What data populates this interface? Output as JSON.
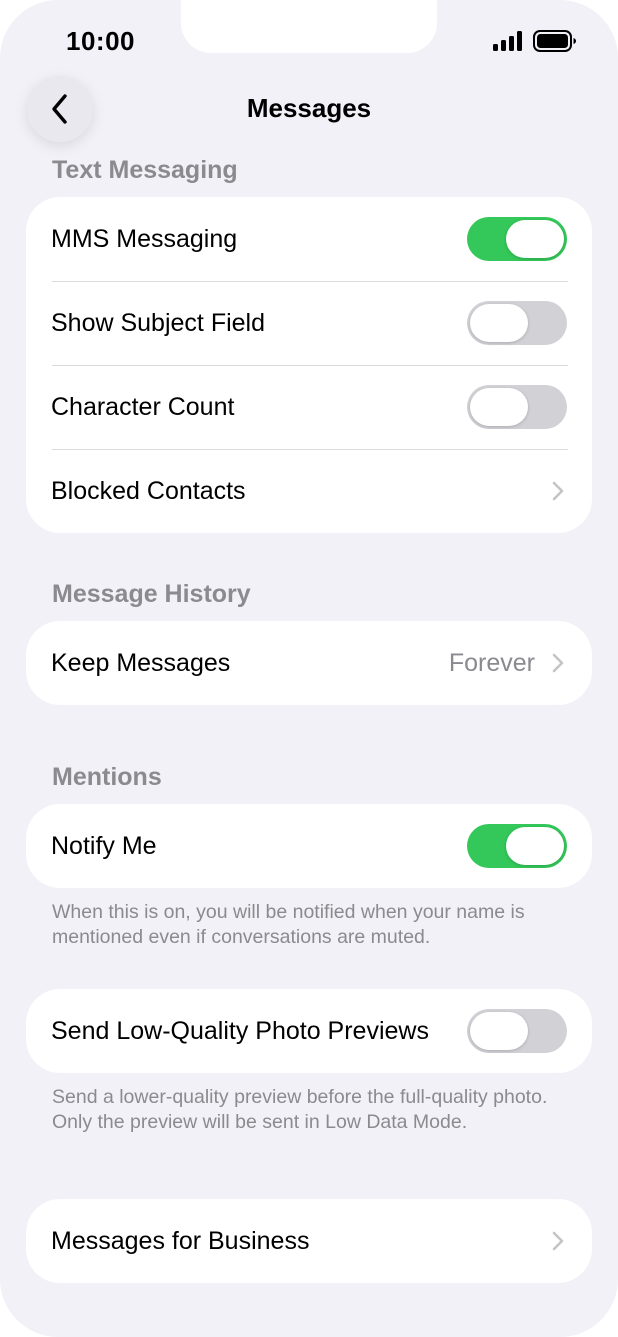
{
  "status_bar": {
    "time": "10:00",
    "icons": [
      "cellular-signal-icon",
      "battery-icon"
    ]
  },
  "nav": {
    "back_icon": "chevron-left-icon",
    "title": "Messages"
  },
  "sections": {
    "text_messaging": {
      "header": "Text Messaging",
      "mms_label": "MMS Messaging",
      "mms_on": true,
      "subject_label": "Show Subject Field",
      "subject_on": false,
      "char_count_label": "Character Count",
      "char_count_on": false,
      "blocked_label": "Blocked Contacts"
    },
    "message_history": {
      "header": "Message History",
      "keep_label": "Keep Messages",
      "keep_value": "Forever"
    },
    "mentions": {
      "header": "Mentions",
      "notify_label": "Notify Me",
      "notify_on": true,
      "footer": "When this is on, you will be notified when your name is mentioned even if conversations are muted."
    },
    "low_quality": {
      "label": "Send Low-Quality Photo Previews",
      "on": false,
      "footer": "Send a lower-quality preview before the full-quality photo. Only the preview will be sent in Low Data Mode."
    },
    "business": {
      "label": "Messages for Business"
    }
  },
  "colors": {
    "toggle_on": "#34c759",
    "toggle_off": "#d1d1d6",
    "background": "#f2f1f7",
    "secondary_text": "#8a8a8f"
  }
}
